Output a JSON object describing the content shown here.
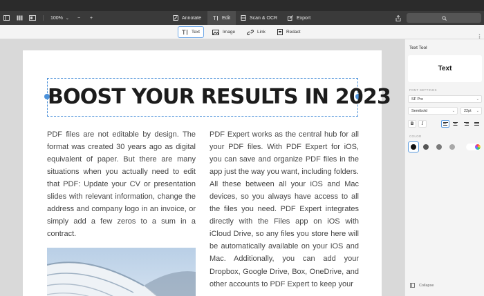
{
  "toolbar": {
    "zoom": "100%",
    "zoom_out": "−",
    "zoom_in": "+",
    "tabs": [
      {
        "label": "Annotate",
        "icon": "annotate-icon"
      },
      {
        "label": "Edit",
        "icon": "text-cursor-icon"
      },
      {
        "label": "Scan & OCR",
        "icon": "scan-icon"
      },
      {
        "label": "Export",
        "icon": "export-icon"
      }
    ],
    "active_tab": "Edit"
  },
  "edit_tools": [
    {
      "label": "Text",
      "icon": "text-tool-icon",
      "active": true
    },
    {
      "label": "Image",
      "icon": "image-icon",
      "active": false
    },
    {
      "label": "Link",
      "icon": "link-icon",
      "active": false
    },
    {
      "label": "Redact",
      "icon": "redact-icon",
      "active": false
    }
  ],
  "document": {
    "headline": "BOOST YOUR RESULTS IN 2023",
    "column_left": "PDF files are not editable by design. The format was created 30 years ago as digital equivalent of paper. But there are many situations when you actually need to edit that PDF: Update your CV or presentation slides with relevant information, change the address and company logo in an invoice, or simply add a few zeros to a sum in a contract.",
    "column_right": "PDF Expert works as the central hub for all your PDF files. With PDF Expert for iOS, you can save and organize PDF files in the app just the way you want, including folders. All these  between all your iOS and Mac devices, so you always have access to all the files you need. PDF Expert integrates directly with the Files app on iOS with iCloud Drive, so any files you store here will be automatically available on your iOS and Mac. Additionally, you can add your Dropbox, Google Drive, Box, OneDrive, and other accounts to PDF Expert to keep your"
  },
  "panel": {
    "title": "Text Tool",
    "preview": "Text",
    "font_settings_label": "FONT SETTINGS",
    "font_family": "SF Pro",
    "font_weight": "Semibold",
    "font_size": "22pt",
    "bold_label": "B",
    "italic_label": "I",
    "alignment": "left",
    "color_label": "COLOR",
    "colors": [
      "#111111",
      "#555555",
      "#7a7a7a",
      "#a8a8a8"
    ],
    "selected_color": "#111111",
    "collapse_label": "Collapse"
  },
  "colors": {
    "accent": "#4a90d9",
    "toolbar_bg": "#3a3a3a"
  }
}
